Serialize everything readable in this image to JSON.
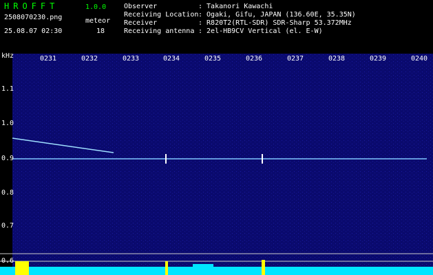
{
  "header": {
    "app_name": "HROFFT",
    "version": "1.0.0",
    "file_name": "2508070230.png",
    "meteor_label": "meteor",
    "datetime": "25.08.07 02:30",
    "meteor_count": "18"
  },
  "info": [
    {
      "label": "Observer",
      "value": ": Takanori Kawachi"
    },
    {
      "label": "Receiving Location",
      "value": ": Ogaki, Gifu, JAPAN (136.60E, 35.35N)"
    },
    {
      "label": "Receiver",
      "value": ": R820T2(RTL-SDR) SDR-Sharp 53.372MHz"
    },
    {
      "label": "Receiving antenna",
      "value": ": 2el-HB9CV Vertical (el. E-W)"
    }
  ],
  "axis": {
    "y_unit": "kHz",
    "x_ticks": [
      "0231",
      "0232",
      "0233",
      "0234",
      "0235",
      "0236",
      "0237",
      "0238",
      "0239",
      "0240"
    ],
    "y_ticks": [
      "1.1",
      "1.0",
      "0.9",
      "0.8",
      "0.7",
      "0.6"
    ]
  },
  "colors": {
    "background": "#000000",
    "spectrogram": "#0a0a6e",
    "signal": "#8fd8ff",
    "activity": "#00e5ff",
    "meteor": "#ffff00",
    "title": "#00ff00"
  }
}
